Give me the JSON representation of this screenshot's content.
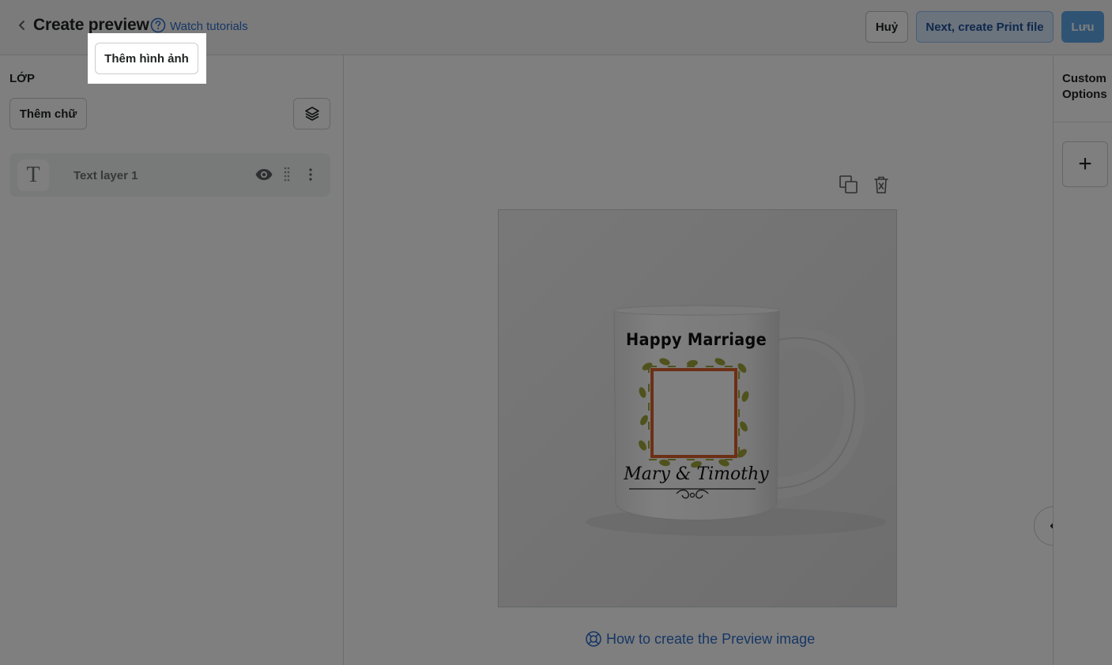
{
  "header": {
    "title": "Create preview",
    "watch_tutorials": "Watch tutorials",
    "cancel_label": "Huỷ",
    "next_label": "Next, create Print file",
    "save_label": "Lưu"
  },
  "left_panel": {
    "title": "LỚP",
    "add_text_label": "Thêm chữ",
    "add_image_label": "Thêm hình ảnh",
    "layers": [
      {
        "type_icon": "T",
        "name": "Text layer 1"
      }
    ]
  },
  "canvas": {
    "mug_heading": "Happy Marriage",
    "mug_names": "Mary & Timothy",
    "help_link": "How to create the Preview image"
  },
  "right_panel": {
    "custom_options_label": "Custom Options",
    "add_symbol": "+"
  },
  "colors": {
    "primary_blue": "#2c6ecb",
    "save_blue": "#5ea6e6",
    "next_bg": "#d6e7fb",
    "frame_orange": "#d9612d",
    "leaf_olive": "#a0a43a"
  }
}
